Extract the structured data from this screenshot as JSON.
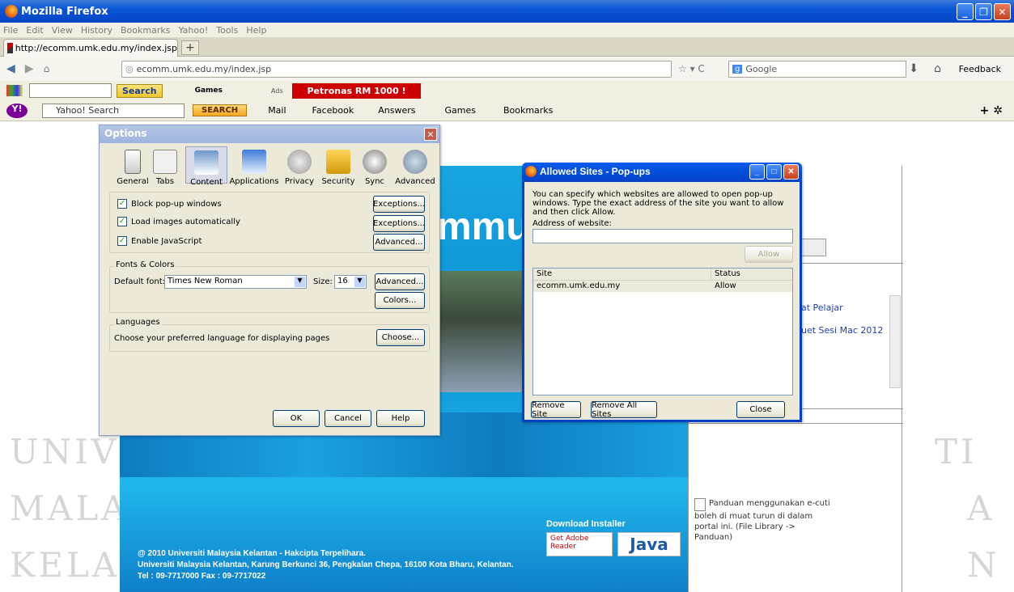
{
  "window": {
    "title": "Mozilla Firefox"
  },
  "menu": [
    "File",
    "Edit",
    "View",
    "History",
    "Bookmarks",
    "Yahoo!",
    "Tools",
    "Help"
  ],
  "tab": {
    "title": "http://ecomm.umk.edu.my/index.jsp",
    "new_tab": "+"
  },
  "nav": {
    "url": "ecomm.umk.edu.my/index.jsp",
    "search_engine": "Google",
    "feedback": "Feedback"
  },
  "toolbar1": {
    "search_btn": "Search",
    "games": "Games",
    "ads": "Ads",
    "promo": "Petronas RM 1000 !"
  },
  "toolbar2": {
    "search_placeholder": "Yahoo! Search",
    "search_btn": "SEARCH",
    "mail": "Mail",
    "facebook": "Facebook",
    "answers": "Answers",
    "games": "Games",
    "bookmarks": "Bookmarks"
  },
  "page": {
    "bg_letters": [
      "UNIVE",
      "MALA",
      "KELA"
    ],
    "bg_letters_right": [
      "TI",
      "A",
      "N"
    ],
    "banner_text": "mmu",
    "download": "Download Installer",
    "adobe": "Get Adobe Reader",
    "java": "Java",
    "footer_line1": "@ 2010 Universiti Malaysia Kelantan - Hakcipta Terpelihara.",
    "footer_line2": "Universiti Malaysia Kelantan, Karung Berkunci 36, Pengkalan Chepa, 16100 Kota Bharu, Kelantan.",
    "footer_line3": "Tel : 09-7717000 Fax : 09-7717022",
    "right_link1": "at Pelajar",
    "right_link2": "uet Sesi Mac 2012",
    "panduan": "Panduan menggunakan e-cuti boleh di muat turun di dalam portal ini. (File Library -> Panduan)"
  },
  "options": {
    "title": "Options",
    "panes": [
      "General",
      "Tabs",
      "Content",
      "Applications",
      "Privacy",
      "Security",
      "Sync",
      "Advanced"
    ],
    "block_popups": "Block pop-up windows",
    "load_images": "Load images automatically",
    "enable_js": "Enable JavaScript",
    "exceptions": "Exceptions...",
    "advanced_btn": "Advanced...",
    "fonts_colors": "Fonts & Colors",
    "default_font_label": "Default font:",
    "default_font": "Times New Roman",
    "size_label": "Size:",
    "size": "16",
    "colors": "Colors...",
    "languages": "Languages",
    "lang_text": "Choose your preferred language for displaying pages",
    "choose": "Choose...",
    "ok": "OK",
    "cancel": "Cancel",
    "help": "Help"
  },
  "popup": {
    "title": "Allowed Sites - Pop-ups",
    "desc": "You can specify which websites are allowed to open pop-up windows. Type the exact address of the site you want to allow and then click Allow.",
    "address_label": "Address of website:",
    "allow": "Allow",
    "col_site": "Site",
    "col_status": "Status",
    "rows": [
      {
        "site": "ecomm.umk.edu.my",
        "status": "Allow"
      }
    ],
    "remove_site": "Remove Site",
    "remove_all": "Remove All Sites",
    "close": "Close"
  }
}
